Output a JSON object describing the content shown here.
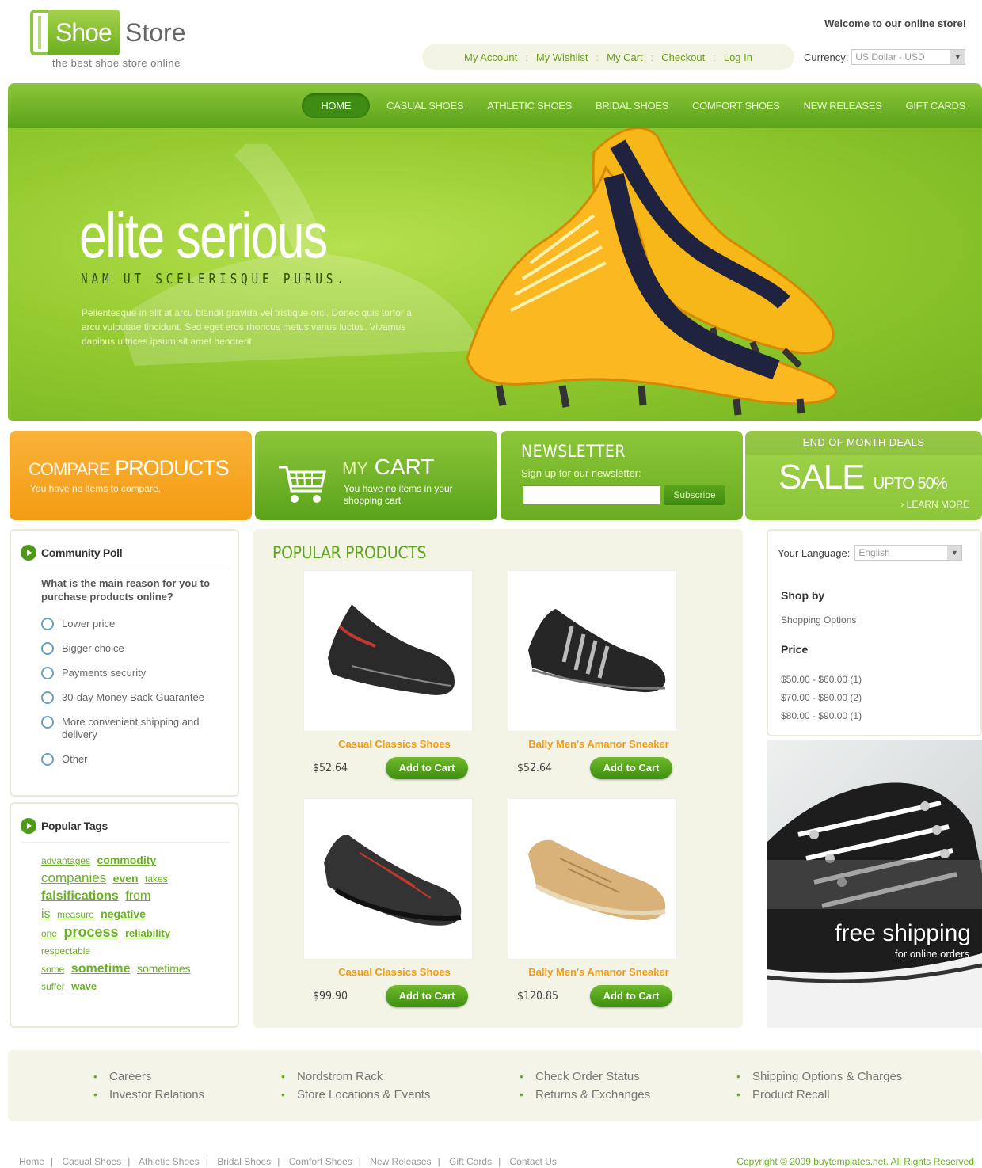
{
  "header": {
    "logo_left": "Shoe",
    "logo_right": "Store",
    "tagline": "the best shoe store online",
    "welcome": "Welcome to our online store!",
    "top_links": [
      "My Account",
      "My Wishlist",
      "My Cart",
      "Checkout",
      "Log In"
    ],
    "currency_label": "Currency:",
    "currency_value": "US Dollar - USD"
  },
  "nav": {
    "items": [
      "HOME",
      "CASUAL SHOES",
      "ATHLETIC SHOES",
      "BRIDAL SHOES",
      "COMFORT SHOES",
      "NEW RELEASES",
      "GIFT CARDS"
    ]
  },
  "hero": {
    "title": "elite serious",
    "subtitle": "NAM UT SCELERISQUE PURUS.",
    "text": "Pellentesque in elit at arcu blandit gravida vel tristique orci. Donec quis tortor a arcu vulputate tincidunt. Sed eget eros rhoncus metus varius luctus. Vivamus dapibus ultrices ipsum sit amet hendrerit."
  },
  "promos": {
    "compare": {
      "title_a": "COMPARE",
      "title_b": "PRODUCTS",
      "text": "You have no items to compare."
    },
    "cart": {
      "title_a": "MY",
      "title_b": "CART",
      "text": "You have no items in your shopping cart."
    },
    "newsletter": {
      "title": "NEWSLETTER",
      "text": "Sign up for our newsletter:",
      "button": "Subscribe"
    },
    "sale": {
      "header": "END OF MONTH DEALS",
      "title": "SALE",
      "sub": "UPTO 50%",
      "more": "LEARN MORE"
    }
  },
  "poll": {
    "title": "Community Poll",
    "question": "What is the main reason for you to purchase products online?",
    "options": [
      "Lower price",
      "Bigger choice",
      "Payments security",
      "30-day Money Back Guarantee",
      "More convenient shipping and delivery",
      "Other"
    ]
  },
  "tags": {
    "title": "Popular Tags",
    "items": [
      "advantages",
      "commodity",
      "companies",
      "even",
      "takes",
      "falsifications",
      "from",
      "is",
      "measure",
      "negative",
      "one",
      "process",
      "reliability",
      "respectable",
      "some",
      "sometime",
      "sometimes",
      "suffer",
      "wave"
    ]
  },
  "products": {
    "title": "POPULAR PRODUCTS",
    "items": [
      {
        "name": "Casual Classics Shoes",
        "price": "$52.64",
        "button": "Add to Cart"
      },
      {
        "name": "Bally Men's Amanor Sneaker",
        "price": "$52.64",
        "button": "Add to Cart"
      },
      {
        "name": "Casual Classics Shoes",
        "price": "$99.90",
        "button": "Add to Cart"
      },
      {
        "name": "Bally Men's Amanor Sneaker",
        "price": "$120.85",
        "button": "Add to Cart"
      }
    ]
  },
  "right": {
    "lang_label": "Your Language:",
    "lang_value": "English",
    "shop_by": "Shop by",
    "shopping_options": "Shopping Options",
    "price": "Price",
    "ranges": [
      "$50.00 - $60.00 (1)",
      "$70.00 - $80.00 (2)",
      "$80.00 - $90.00 (1)"
    ],
    "ship_title": "free shipping",
    "ship_sub": "for online orders"
  },
  "footer": {
    "col1": [
      "Careers",
      "Investor Relations"
    ],
    "col2": [
      "Nordstrom Rack",
      "Store Locations & Events"
    ],
    "col3": [
      "Check Order Status",
      "Returns & Exchanges"
    ],
    "col4": [
      "Shipping Options & Charges",
      "Product Recall"
    ],
    "bottom_links": [
      "Home",
      "Casual Shoes",
      "Athletic Shoes",
      "Bridal Shoes",
      "Comfort Shoes",
      "New Releases",
      "Gift Cards",
      "Contact Us"
    ],
    "copyright": "Copyright © 2009 buytemplates.net. All Rights Reserved"
  }
}
